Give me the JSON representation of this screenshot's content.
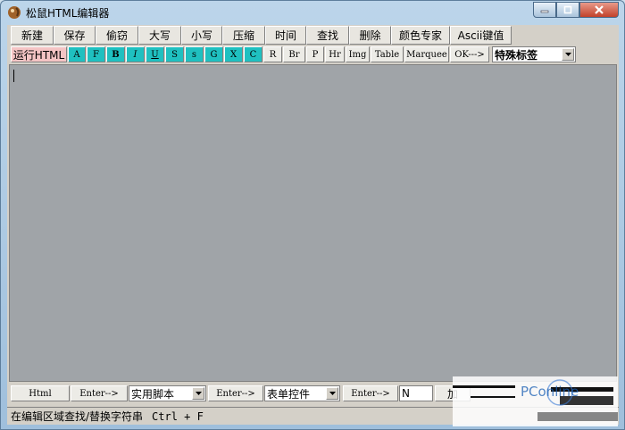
{
  "window": {
    "title": "松鼠HTML编辑器"
  },
  "menu": [
    {
      "label": "新建"
    },
    {
      "label": "保存"
    },
    {
      "label": "偷窃"
    },
    {
      "label": "大写"
    },
    {
      "label": "小写"
    },
    {
      "label": "压缩"
    },
    {
      "label": "时间"
    },
    {
      "label": "查找"
    },
    {
      "label": "删除"
    },
    {
      "label": "颜色专家"
    },
    {
      "label": "Ascii键值"
    }
  ],
  "tags": {
    "run": "运行HTML",
    "format_buttons": [
      {
        "label": "A",
        "style": "teal"
      },
      {
        "label": "F",
        "style": "teal"
      },
      {
        "label": "B",
        "style": "teal"
      },
      {
        "label": "I",
        "style": "teal"
      },
      {
        "label": "U",
        "style": "teal"
      },
      {
        "label": "S",
        "style": "teal"
      },
      {
        "label": "s",
        "style": "teal"
      },
      {
        "label": "G",
        "style": "teal"
      },
      {
        "label": "X",
        "style": "teal"
      },
      {
        "label": "C",
        "style": "teal"
      },
      {
        "label": "R",
        "style": "plain"
      },
      {
        "label": "Br",
        "style": "plain"
      },
      {
        "label": "P",
        "style": "plain"
      },
      {
        "label": "Hr",
        "style": "plain"
      },
      {
        "label": "Img",
        "style": "plain"
      },
      {
        "label": "Table",
        "style": "plain"
      },
      {
        "label": "Marquee",
        "style": "plain"
      },
      {
        "label": "OK--->",
        "style": "plain"
      }
    ],
    "special_select": "特殊标签"
  },
  "bottom": {
    "html_button": "Html",
    "enter1": "Enter-->",
    "script_select": "实用脚本",
    "enter2": "Enter-->",
    "form_select": "表单控件",
    "enter3": "Enter-->",
    "n_field": "N",
    "partial_button": "加"
  },
  "status": {
    "text": "在编辑区域查找/替换字符串",
    "shortcut": "Ctrl + F"
  },
  "watermark": {
    "text": "PConline"
  },
  "colors": {
    "teal": "#1fc0c0",
    "pink": "#f4c4c4",
    "editor_bg": "#a0a4a8",
    "face": "#d4d0c8"
  }
}
